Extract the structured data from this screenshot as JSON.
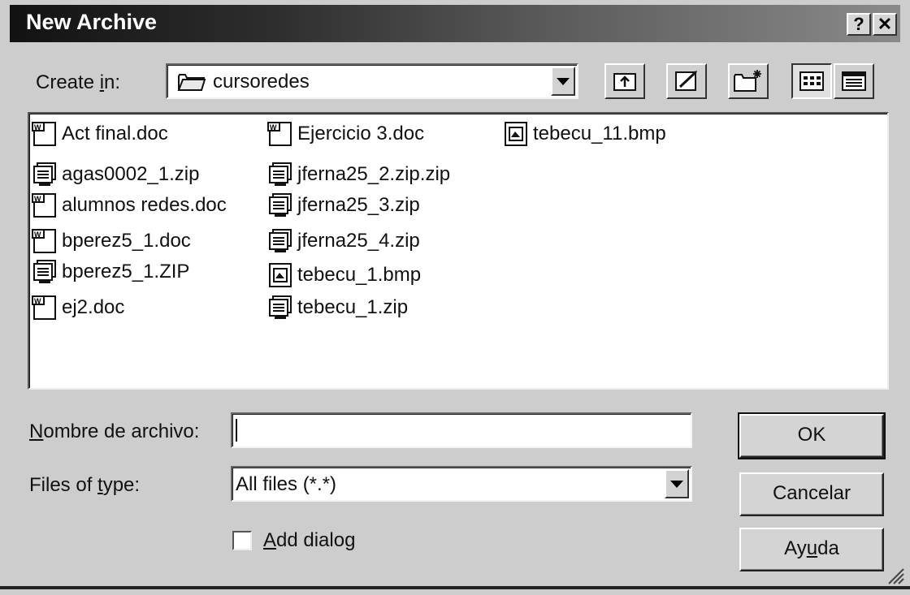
{
  "window": {
    "title": "New Archive",
    "help_label": "?",
    "close_label": "✕"
  },
  "create_in": {
    "label_before": "Create ",
    "label_accel": "i",
    "label_after": "n:",
    "folder": "cursoredes"
  },
  "files": [
    {
      "name": "Act final.doc",
      "type": "doc"
    },
    {
      "name": "agas0002_1.zip",
      "type": "zip"
    },
    {
      "name": "alumnos redes.doc",
      "type": "doc"
    },
    {
      "name": "bperez5_1.doc",
      "type": "doc"
    },
    {
      "name": "bperez5_1.ZIP",
      "type": "zip"
    },
    {
      "name": "ej2.doc",
      "type": "doc"
    },
    {
      "name": "Ejercicio 3.doc",
      "type": "doc"
    },
    {
      "name": "jferna25_2.zip.zip",
      "type": "zip"
    },
    {
      "name": "jferna25_3.zip",
      "type": "zip"
    },
    {
      "name": "jferna25_4.zip",
      "type": "zip"
    },
    {
      "name": "tebecu_1.bmp",
      "type": "bmp"
    },
    {
      "name": "tebecu_1.zip",
      "type": "zip"
    },
    {
      "name": "tebecu_11.bmp",
      "type": "bmp"
    }
  ],
  "filename_field": {
    "label_accel": "N",
    "label_rest": "ombre de archivo:",
    "value": ""
  },
  "filetype": {
    "label_before": "Files of ",
    "label_accel": "t",
    "label_after": "ype:",
    "value": "All files (*.*)"
  },
  "add_dialog": {
    "label_accel": "A",
    "label_rest": "dd dialog",
    "checked": false
  },
  "buttons": {
    "ok": "OK",
    "cancel": "Cancelar",
    "help_before": "Ay",
    "help_accel": "u",
    "help_after": "da"
  }
}
